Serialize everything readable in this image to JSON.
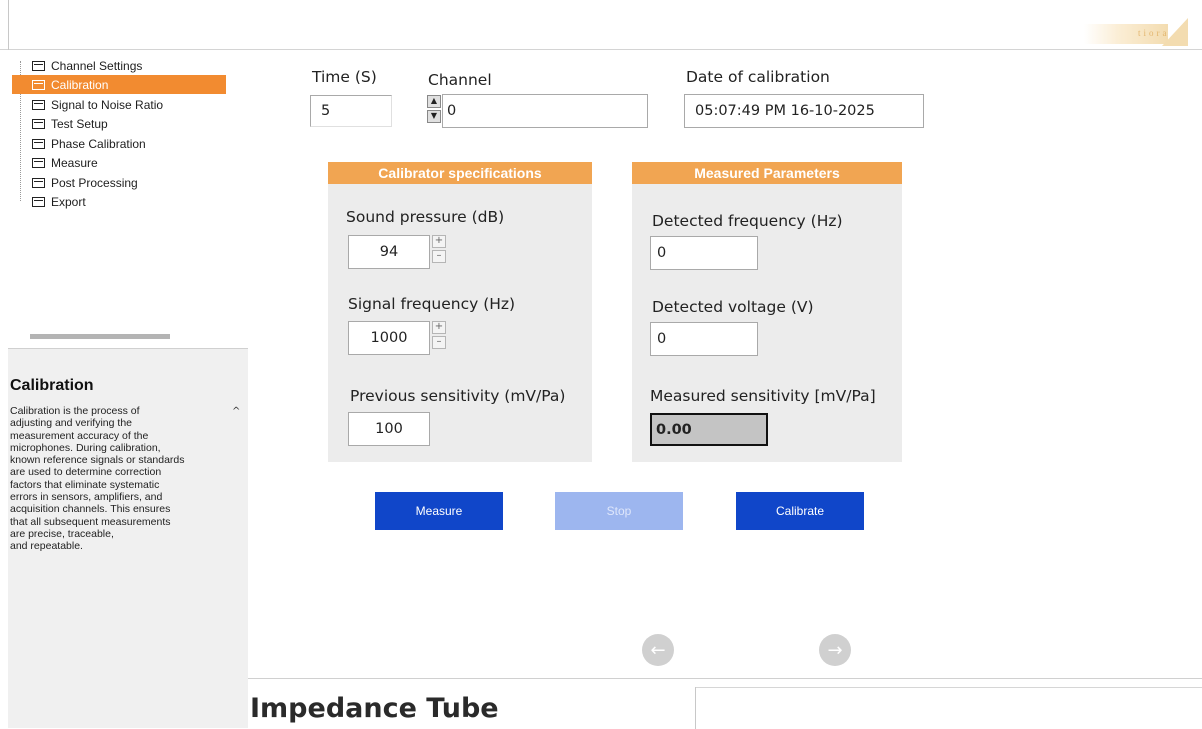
{
  "brand": {
    "logo_text": "tiora"
  },
  "sidebar": {
    "items": [
      {
        "label": "Channel Settings",
        "selected": false
      },
      {
        "label": "Calibration",
        "selected": true
      },
      {
        "label": "Signal to Noise Ratio",
        "selected": false
      },
      {
        "label": "Test Setup",
        "selected": false
      },
      {
        "label": "Phase Calibration",
        "selected": false
      },
      {
        "label": "Measure",
        "selected": false
      },
      {
        "label": "Post Processing",
        "selected": false
      },
      {
        "label": "Export",
        "selected": false
      }
    ]
  },
  "help": {
    "title": "Calibration",
    "body": "Calibration is the process of\nadjusting and verifying the\nmeasurement accuracy of the\nmicrophones. During calibration,\nknown reference signals or standards\nare used to determine correction\nfactors that eliminate systematic\nerrors in sensors, amplifiers, and\nacquisition channels. This ensures\nthat all subsequent measurements\nare precise, traceable,\n and repeatable."
  },
  "main": {
    "time_label": "Time (S)",
    "time_value": "5",
    "channel_label": "Channel",
    "channel_value": "0",
    "date_label": "Date of calibration",
    "date_value": "05:07:49 PM 16-10-2025"
  },
  "calibrator": {
    "header": "Calibrator specifications",
    "sound_pressure_label": "Sound pressure (dB)",
    "sound_pressure_value": "94",
    "signal_freq_label": "Signal frequency (Hz)",
    "signal_freq_value": "1000",
    "prev_sens_label": "Previous sensitivity (mV/Pa)",
    "prev_sens_value": "100"
  },
  "measured": {
    "header": "Measured Parameters",
    "det_freq_label": "Detected frequency (Hz)",
    "det_freq_value": "0",
    "det_volt_label": "Detected voltage (V)",
    "det_volt_value": "0",
    "meas_sens_label": "Measured sensitivity [mV/Pa]",
    "meas_sens_value": "0.00"
  },
  "buttons": {
    "measure": "Measure",
    "stop": "Stop",
    "calibrate": "Calibrate"
  },
  "nav": {
    "prev_icon": "arrow-left-icon",
    "next_icon": "arrow-right-icon"
  },
  "footer": {
    "title": "Impedance Tube"
  },
  "colors": {
    "accent": "#f28b30",
    "panel_header": "#f1a552",
    "primary_button": "#1046c9",
    "disabled_button": "#9db6ef"
  }
}
